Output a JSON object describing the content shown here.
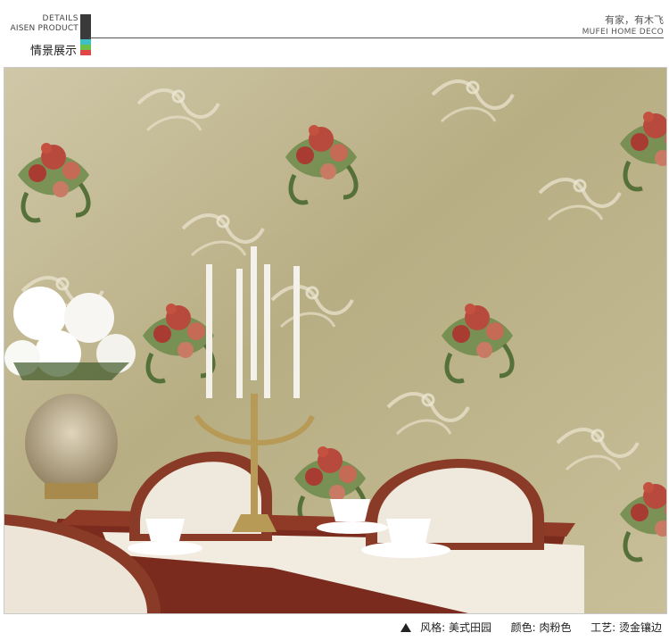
{
  "header": {
    "details": "DETAILS",
    "product": "AISEN PRODUCT",
    "section_title": "情景展示",
    "brand_cn": "有家，有木飞",
    "brand_en": "MUFEI  HOME DECO"
  },
  "colors": {
    "bar_dark": "#3a3a3a",
    "bar_teal": "#3fc0c9",
    "bar_green": "#6cc04a",
    "bar_red": "#e2464b"
  },
  "photo": {
    "subject": "floral wallpaper dining room scene",
    "icons": [
      "flower-motif",
      "candelabra",
      "chair",
      "bowl",
      "vase"
    ]
  },
  "footer": {
    "style_label": "风格: 美式田园",
    "color_label": "颜色: 肉粉色",
    "craft_label": "工艺: 烫金镶边"
  }
}
